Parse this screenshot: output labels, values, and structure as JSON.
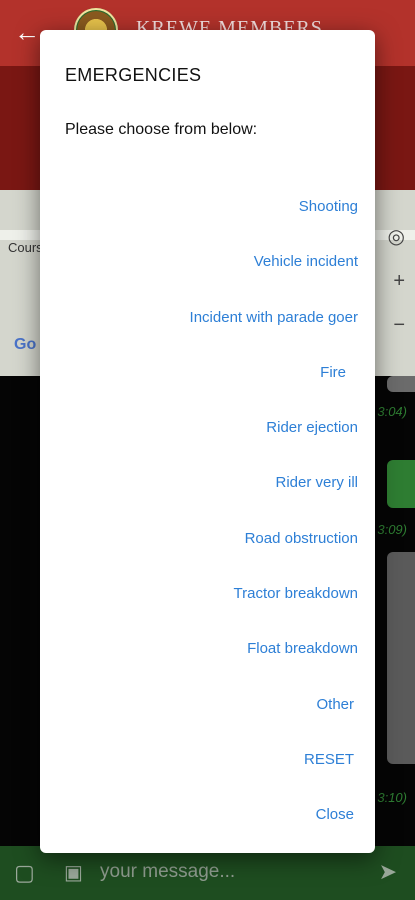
{
  "app_bar": {
    "back_icon": "arrow-left-icon",
    "title": "KREWE MEMBERS"
  },
  "map": {
    "label": "Cours",
    "logo": "Go"
  },
  "chat": {
    "timestamps": [
      "3:04)",
      "3:09)",
      "3:10)"
    ]
  },
  "input_bar": {
    "placeholder": "your message..."
  },
  "dialog": {
    "title": "EMERGENCIES",
    "subtitle": "Please choose from below:",
    "options": [
      "Shooting",
      "Vehicle incident",
      "Incident with parade goer",
      "Fire",
      "Rider ejection",
      "Rider very ill",
      "Road obstruction",
      "Tractor breakdown",
      "Float breakdown",
      "Other",
      "RESET",
      "Close"
    ]
  },
  "colors": {
    "app_bar": "#b3322b",
    "link": "#2d7fd6",
    "input_bar": "#1e4d20"
  }
}
